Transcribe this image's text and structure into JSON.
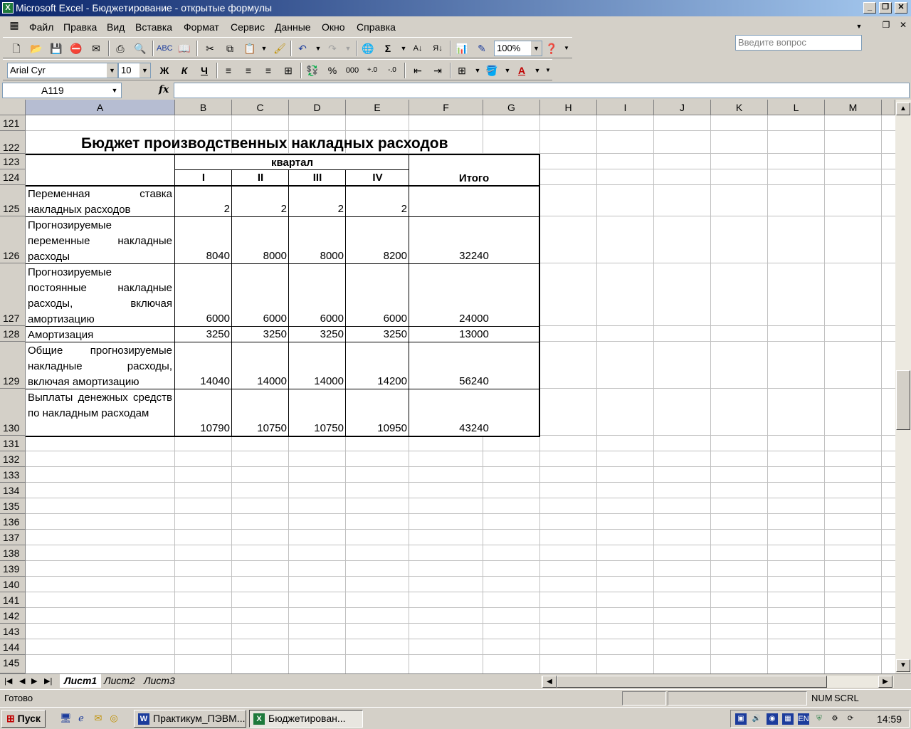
{
  "window": {
    "title": "Microsoft Excel - Бюджетирование - открытые формулы",
    "app_icon": "excel-icon"
  },
  "menu": [
    "Файл",
    "Правка",
    "Вид",
    "Вставка",
    "Формат",
    "Сервис",
    "Данные",
    "Окно",
    "Справка"
  ],
  "help_box": {
    "placeholder": "Введите вопрос"
  },
  "toolbar_standard": {
    "zoom": "100%"
  },
  "toolbar_format": {
    "font": "Arial Cyr",
    "size": "10",
    "bold": "Ж",
    "italic": "К",
    "underline": "Ч",
    "percent": "%",
    "thousands": "000"
  },
  "formula_bar": {
    "name_box": "A119",
    "fx": "fx",
    "formula": ""
  },
  "columns": [
    "A",
    "B",
    "C",
    "D",
    "E",
    "F",
    "G",
    "H",
    "I",
    "J",
    "K",
    "L",
    "M"
  ],
  "sheet": {
    "title": "Бюджет производственных накладных расходов",
    "quarter_header": "квартал",
    "quarters": [
      "I",
      "II",
      "III",
      "IV"
    ],
    "total_header": "Итого",
    "rows": [
      {
        "row": "125",
        "label": "Переменная ставка накладных расходов",
        "values": [
          "2",
          "2",
          "2",
          "2"
        ],
        "total": ""
      },
      {
        "row": "126",
        "label": "Прогнозируемые переменные накладные расходы",
        "values": [
          "8040",
          "8000",
          "8000",
          "8200"
        ],
        "total": "32240"
      },
      {
        "row": "127",
        "label": "Прогнозируемые постоянные накладные расходы, включая амортизацию",
        "values": [
          "6000",
          "6000",
          "6000",
          "6000"
        ],
        "total": "24000"
      },
      {
        "row": "128",
        "label": "Амортизация",
        "values": [
          "3250",
          "3250",
          "3250",
          "3250"
        ],
        "total": "13000"
      },
      {
        "row": "129",
        "label": "Общие прогнозируемые накладные расходы, включая амортизацию",
        "values": [
          "14040",
          "14000",
          "14000",
          "14200"
        ],
        "total": "56240"
      },
      {
        "row": "130",
        "label": "Выплаты денежных средств по накладным расходам",
        "values": [
          "10790",
          "10750",
          "10750",
          "10950"
        ],
        "total": "43240"
      }
    ]
  },
  "row_numbers": [
    "121",
    "122",
    "123",
    "124",
    "125",
    "126",
    "127",
    "128",
    "129",
    "130",
    "131",
    "132",
    "133",
    "134",
    "135",
    "136",
    "137",
    "138",
    "139",
    "140",
    "141",
    "142",
    "143",
    "144",
    "145"
  ],
  "sheet_tabs": [
    "Лист1",
    "Лист2",
    "Лист3"
  ],
  "status": {
    "ready": "Готово",
    "num": "NUM",
    "scrl": "SCRL"
  },
  "taskbar": {
    "start": "Пуск",
    "tasks": [
      "Практикум_ПЭВМ...",
      "Бюджетирован..."
    ],
    "lang": "EN",
    "clock": "14:59"
  }
}
